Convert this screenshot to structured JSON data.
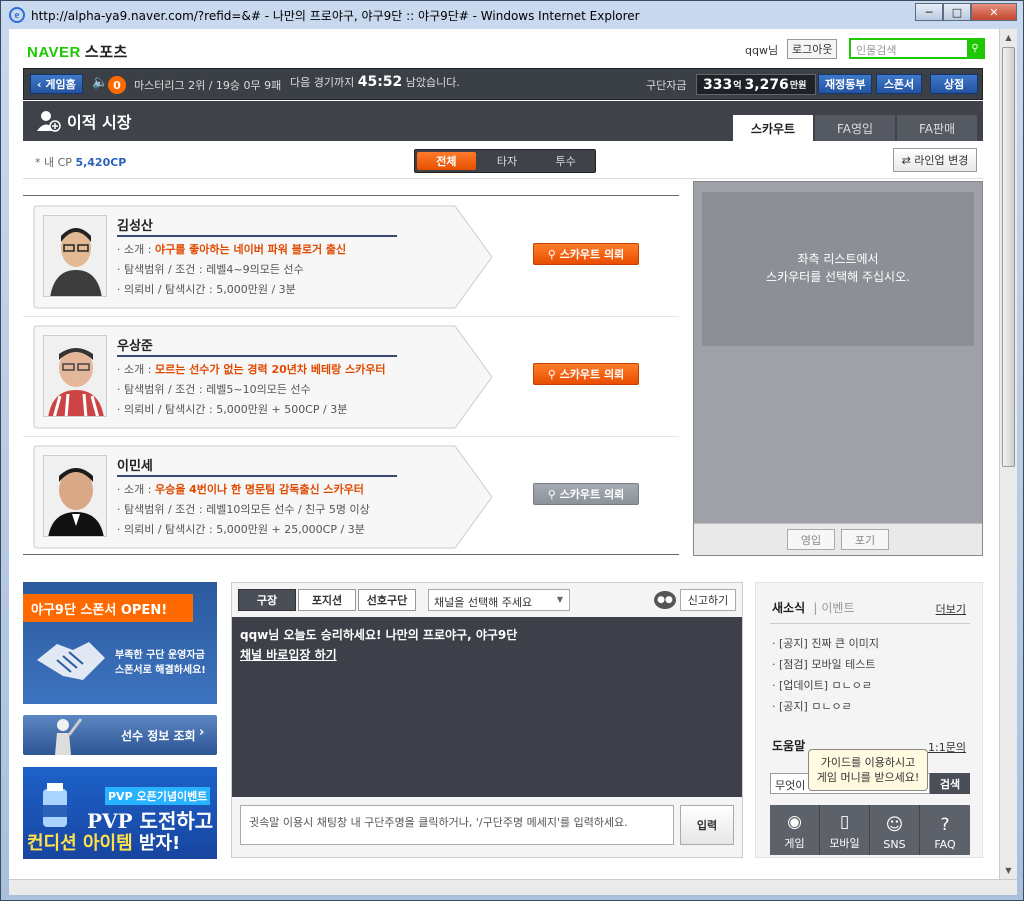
{
  "window": {
    "title": "http://alpha-ya9.naver.com/?refid=&# - 나만의 프로야구, 야구9단 :: 야구9단# - Windows Internet Explorer",
    "buttons": [
      "─",
      "□",
      "✕"
    ]
  },
  "top": {
    "brand": "NAVER",
    "section": "스포츠",
    "user": "qqw님",
    "logout": "로그아웃",
    "search_placeholder": "인물검색"
  },
  "gamebar": {
    "home": "게임홈",
    "mail_count": "0",
    "record": "마스터리그 2위 / 19승 0무 9패",
    "next_game_prefix": "다음 경기까지",
    "countdown": "45:52",
    "next_game_suffix": "남았습니다.",
    "funds_label": "구단자금",
    "funds_eok": "333",
    "funds_eok_unit": "억",
    "funds_man": "3,276",
    "funds_man_unit": "만원",
    "sync": "재정동부",
    "sponsor": "스폰서",
    "shop": "상점"
  },
  "page": {
    "title": "이적 시장",
    "tabs": [
      "스카우트",
      "FA영입",
      "FA판매"
    ],
    "active_tab": 0
  },
  "cp": {
    "label": "* 내 CP",
    "value": "5,420CP"
  },
  "filter": {
    "options": [
      "전체",
      "타자",
      "투수"
    ],
    "active": 0
  },
  "lineup_button": "라인업 변경",
  "scouts": [
    {
      "name": "김성산",
      "intro_label": "소개 :",
      "intro": "야구를 좋아하는 네이버 파워 블로거 출신",
      "range_label": "탐색범위 / 조건 :",
      "range": "레벨4~9의모든 선수",
      "fee_label": "의뢰비 / 탐색시간 :",
      "fee": "5,000만원 / 3분",
      "button": "스카우트 의뢰",
      "enabled": true
    },
    {
      "name": "우상준",
      "intro_label": "소개 :",
      "intro": "모르는 선수가 없는 경력 20년차 베테랑 스카우터",
      "range_label": "탐색범위 / 조건 :",
      "range": "레벨5~10의모든 선수",
      "fee_label": "의뢰비 / 탐색시간 :",
      "fee": "5,000만원 + 500CP / 3분",
      "button": "스카우트 의뢰",
      "enabled": true
    },
    {
      "name": "이민세",
      "intro_label": "소개 :",
      "intro": "우승을 4번이나 한 명문팀 감독출신 스카우터",
      "range_label": "탐색범위 / 조건 :",
      "range": "레벨10의모든 선수 / 친구 5명 이상",
      "fee_label": "의뢰비 / 탐색시간 :",
      "fee": "5,000만원 + 25,000CP / 3분",
      "button": "스카우트 의뢰",
      "enabled": false
    }
  ],
  "right_panel": {
    "line1": "좌측 리스트에서",
    "line2": "스카우터를 선택해 주십시오.",
    "hire": "영입",
    "abandon": "포기"
  },
  "banners": {
    "sponsor_title": "야구9단 스폰서 OPEN!",
    "sponsor_l1": "부족한 구단 운영자금",
    "sponsor_l2": "스폰서로 해결하세요!",
    "player_info": "선수 정보 조회",
    "pvp_tag": "PVP 오픈기념이벤트",
    "pvp_l1": "PVP 도전하고",
    "pvp_l2a": "컨디션 아이템",
    "pvp_l2b": " 받자!"
  },
  "chat": {
    "tabs": [
      "구장",
      "포지션",
      "선호구단"
    ],
    "channel_placeholder": "채널을 선택해 주세요",
    "report": "신고하기",
    "msg1": "qqw님 오늘도 승리하세요! 나만의 프로야구, 야구9단",
    "msg2": "채널 바로입장 하기",
    "input_hint": "귓속말 이용시 채팅창 내 구단주명을 클릭하거나, '/구단주명 메세지'를 입력하세요.",
    "send": "입력"
  },
  "news": {
    "title": "새소식",
    "event": "이벤트",
    "more": "더보기",
    "items": [
      "[공지] 진짜 큰 이미지",
      "[점검] 모바일 테스트",
      "[업데이트] ㅁㄴㅇㄹ",
      "[공지] ㅁㄴㅇㄹ"
    ]
  },
  "help": {
    "title": "도움말",
    "qa": "1:1문의",
    "input": "무엇이",
    "search": "검색",
    "tooltip_l1": "가이드를 이용하시고",
    "tooltip_l2": "게임 머니를 받으세요!",
    "quick": [
      "게임",
      "모바일",
      "SNS",
      "FAQ"
    ]
  },
  "colors": {
    "accent_orange": "#ff6a00",
    "naver_green": "#1ec800",
    "dark": "#3f4249",
    "blue": "#2b62b8"
  }
}
